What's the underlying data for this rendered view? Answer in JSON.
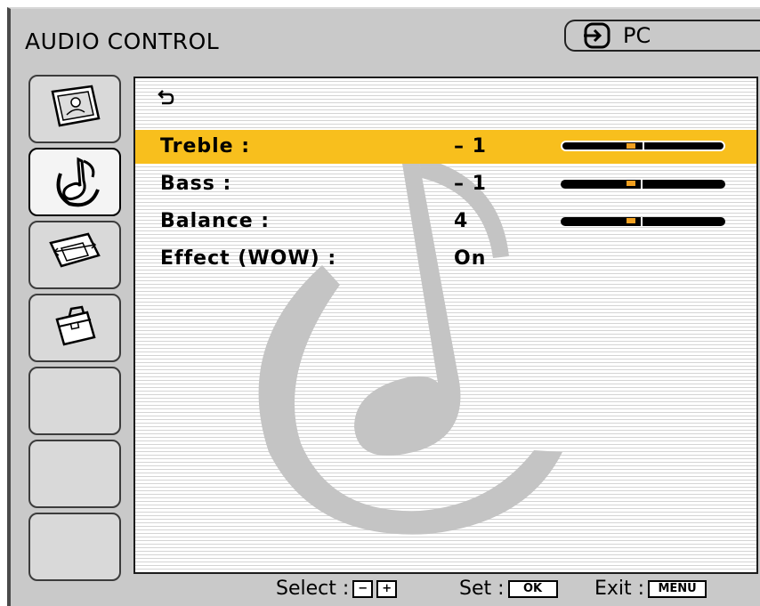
{
  "header": {
    "title": "AUDIO CONTROL",
    "source_label": "PC",
    "source_icon": "input-source-icon"
  },
  "tabs": [
    {
      "icon": "picture-icon",
      "active": false
    },
    {
      "icon": "music-note-icon",
      "active": true
    },
    {
      "icon": "screen-adjust-icon",
      "active": false
    },
    {
      "icon": "toolbox-icon",
      "active": false
    },
    {
      "icon": "",
      "active": false
    },
    {
      "icon": "",
      "active": false
    },
    {
      "icon": "",
      "active": false
    }
  ],
  "menu": {
    "back_icon": "back-arrow-icon",
    "items": [
      {
        "label": "Treble :",
        "value": "– 1",
        "level": 0.4,
        "selected": true
      },
      {
        "label": "Bass :",
        "value": "– 1",
        "level": 0.4,
        "selected": false
      },
      {
        "label": "Balance :",
        "value": "4",
        "level": 0.4,
        "selected": false
      },
      {
        "label": "Effect (WOW) :",
        "value": "On",
        "selected": false
      }
    ]
  },
  "footer": {
    "select_label": "Select :",
    "select_minus": "−",
    "select_plus": "+",
    "set_label": "Set :",
    "set_key": "OK",
    "exit_label": "Exit :",
    "exit_key": "MENU"
  },
  "colors": {
    "highlight": "#f8bf1d",
    "frame": "#c9c9c9",
    "knob": "#f0a020"
  }
}
